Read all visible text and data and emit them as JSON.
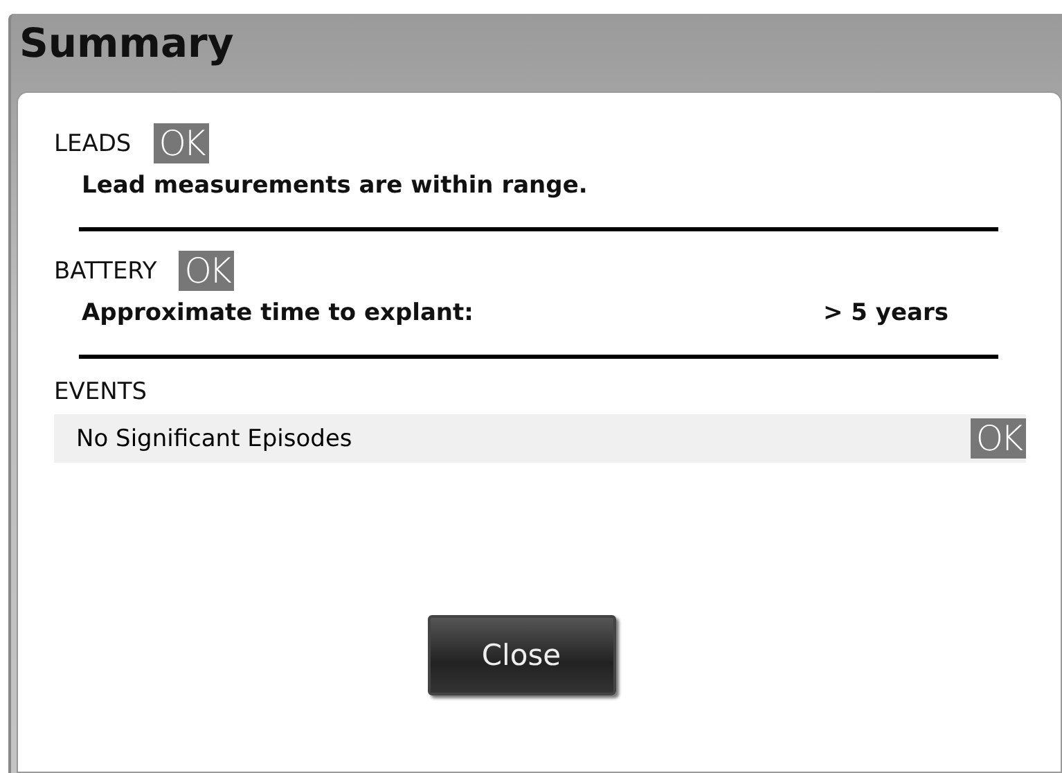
{
  "window": {
    "title": "Summary"
  },
  "sections": [
    {
      "kind": "status",
      "heading": "LEADS",
      "status": "OK",
      "message": "Lead measurements are within range."
    },
    {
      "kind": "status",
      "heading": "BATTERY",
      "status": "OK",
      "message": "Approximate time to explant:",
      "value": "> 5 years"
    },
    {
      "kind": "row",
      "heading": "EVENTS",
      "message": "No Significant Episodes",
      "status": "OK"
    }
  ],
  "buttons": [
    "Close"
  ]
}
